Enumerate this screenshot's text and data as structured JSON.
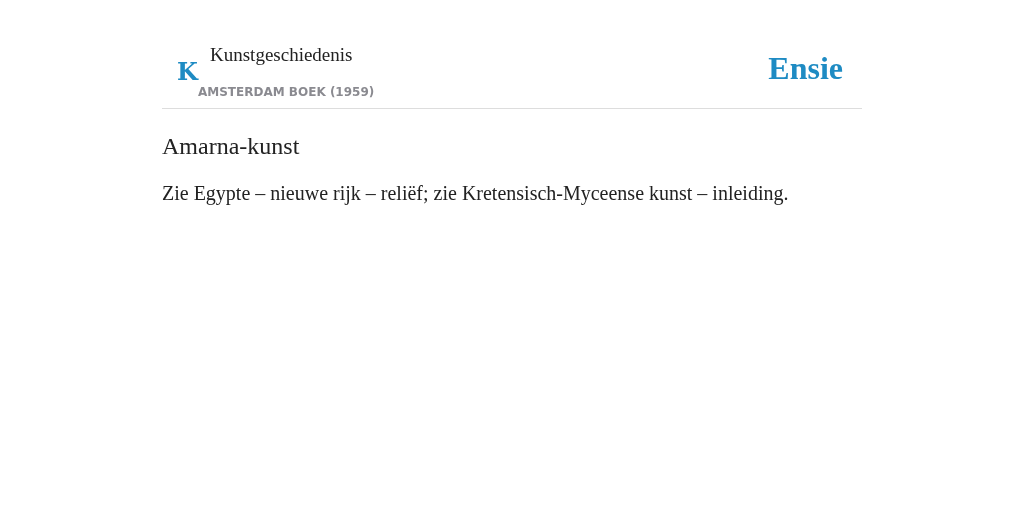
{
  "header": {
    "letter": "K",
    "book_title": "Kunstgeschiedenis",
    "publisher": "AMSTERDAM BOEK (1959)",
    "logo": "Ensie"
  },
  "article": {
    "title": "Amarna-kunst",
    "text": "Zie Egypte – nieuwe rijk – reliëf; zie Kretensisch-Myceense kunst – inleiding."
  }
}
